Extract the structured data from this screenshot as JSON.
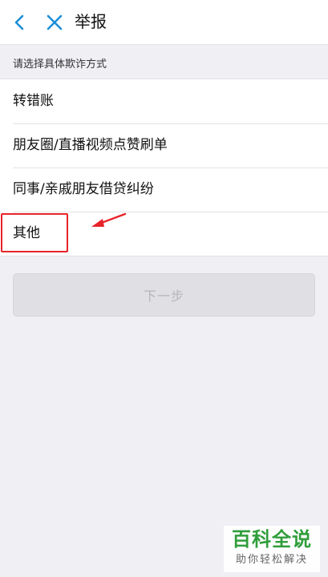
{
  "header": {
    "title": "举报",
    "back_icon": "chevron-left-icon",
    "close_icon": "close-icon",
    "icon_color": "#1b8fd8"
  },
  "section_label": "请选择具体欺诈方式",
  "options": [
    {
      "label": "转错账"
    },
    {
      "label": "朋友圈/直播视频点赞刷单"
    },
    {
      "label": "同事/亲戚朋友借贷纠纷"
    },
    {
      "label": "其他"
    }
  ],
  "next_button": {
    "label": "下一步",
    "enabled": false
  },
  "annotation": {
    "color": "#e8232a"
  },
  "watermark": {
    "main": "百科全说",
    "sub": "助你轻松解决"
  }
}
